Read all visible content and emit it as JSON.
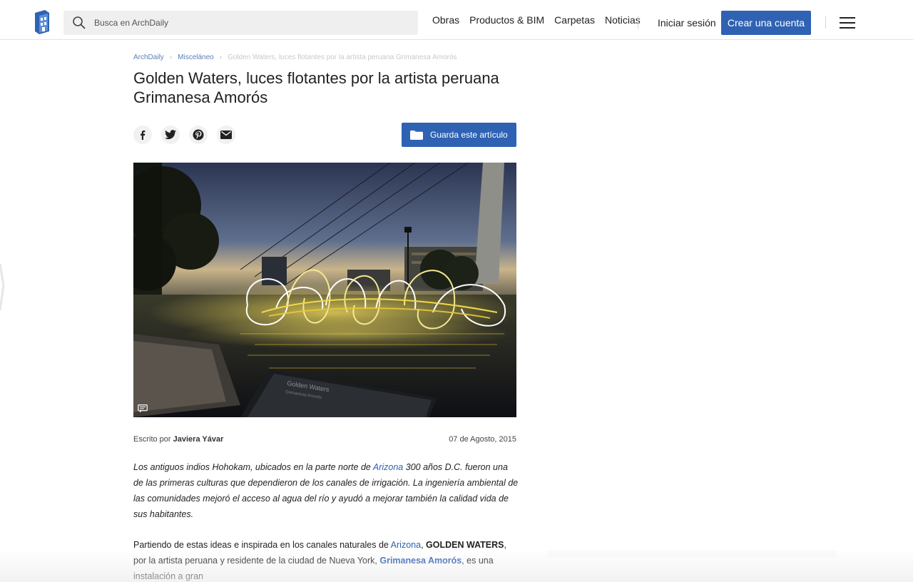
{
  "header": {
    "search_placeholder": "Busca en ArchDaily",
    "nav": [
      "Obras",
      "Productos & BIM",
      "Carpetas",
      "Noticias"
    ],
    "login": "Iniciar sesión",
    "signup": "Crear una cuenta"
  },
  "breadcrumb": {
    "home": "ArchDaily",
    "section": "Misceláneo",
    "current": "Golden Waters, luces flotantes por la artista peruana Grimanesa Amorós"
  },
  "article": {
    "title": "Golden Waters, luces flotantes por la artista peruana Grimanesa Amorós",
    "save_label": "Guarda este artículo",
    "share_icons": [
      "facebook-icon",
      "twitter-icon",
      "pinterest-icon",
      "email-icon"
    ],
    "photo_sign_title": "Golden Waters",
    "photo_sign_author": "Grimanesa Amorós",
    "byline_prefix": "Escrito por",
    "author": "Javiera Yávar",
    "date": "07 de Agosto, 2015",
    "p1_a": "Los antiguos indios Hohokam, ubicados en la parte norte de ",
    "p1_link": "Arizona",
    "p1_b": " 300 años D.C. fueron una de las primeras culturas que dependieron de los canales de irrigación. La ingeniería ambiental de las comunidades mejoró el acceso al agua del río y ayudó a mejorar también la calidad vida de sus habitantes.",
    "p2_a": "Partiendo de estas ideas e inspirada en los canales naturales de ",
    "p2_link": "Arizona",
    "p2_b": ", ",
    "p2_bold": "GOLDEN WATERS",
    "p2_c": ", por la artista peruana y residente de la ciudad de Nueva York, ",
    "p2_link2": "Grimanesa Amorós",
    "p2_d": ", es una instalación a gran"
  },
  "colors": {
    "accent": "#2f62b3",
    "link": "#2f62b3"
  }
}
